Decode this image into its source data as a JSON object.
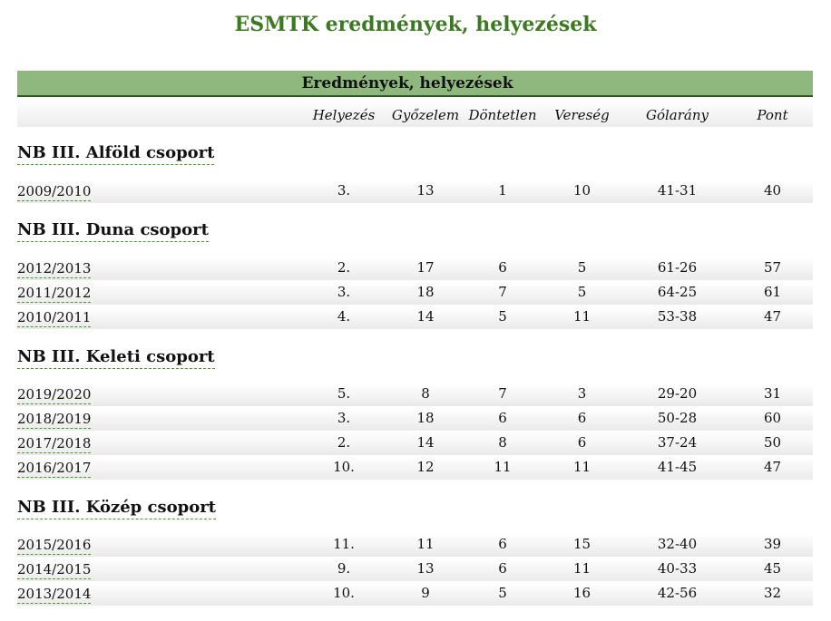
{
  "page": {
    "title": "ESMTK eredmények, helyezések"
  },
  "table": {
    "title": "Eredmények, helyezések",
    "columns": [
      "Helyezés",
      "Győzelem",
      "Döntetlen",
      "Vereség",
      "Gólarány",
      "Pont"
    ],
    "groups": [
      {
        "name": "NB III. Alföld csoport",
        "rows": [
          {
            "season": "2009/2010",
            "cells": [
              "3.",
              "13",
              "1",
              "10",
              "41-31",
              "40"
            ]
          }
        ]
      },
      {
        "name": "NB III. Duna csoport",
        "rows": [
          {
            "season": "2012/2013",
            "cells": [
              "2.",
              "17",
              "6",
              "5",
              "61-26",
              "57"
            ]
          },
          {
            "season": "2011/2012",
            "cells": [
              "3.",
              "18",
              "7",
              "5",
              "64-25",
              "61"
            ]
          },
          {
            "season": "2010/2011",
            "cells": [
              "4.",
              "14",
              "5",
              "11",
              "53-38",
              "47"
            ]
          }
        ]
      },
      {
        "name": "NB III. Keleti csoport",
        "rows": [
          {
            "season": "2019/2020",
            "cells": [
              "5.",
              "8",
              "7",
              "3",
              "29-20",
              "31"
            ]
          },
          {
            "season": "2018/2019",
            "cells": [
              "3.",
              "18",
              "6",
              "6",
              "50-28",
              "60"
            ]
          },
          {
            "season": "2017/2018",
            "cells": [
              "2.",
              "14",
              "8",
              "6",
              "37-24",
              "50"
            ]
          },
          {
            "season": "2016/2017",
            "cells": [
              "10.",
              "12",
              "11",
              "11",
              "41-45",
              "47"
            ]
          }
        ]
      },
      {
        "name": "NB III. Közép csoport",
        "rows": [
          {
            "season": "2015/2016",
            "cells": [
              "11.",
              "11",
              "6",
              "15",
              "32-40",
              "39"
            ]
          },
          {
            "season": "2014/2015",
            "cells": [
              "9.",
              "13",
              "6",
              "11",
              "40-33",
              "45"
            ]
          },
          {
            "season": "2013/2014",
            "cells": [
              "10.",
              "9",
              "5",
              "16",
              "42-56",
              "32"
            ]
          }
        ]
      }
    ]
  }
}
